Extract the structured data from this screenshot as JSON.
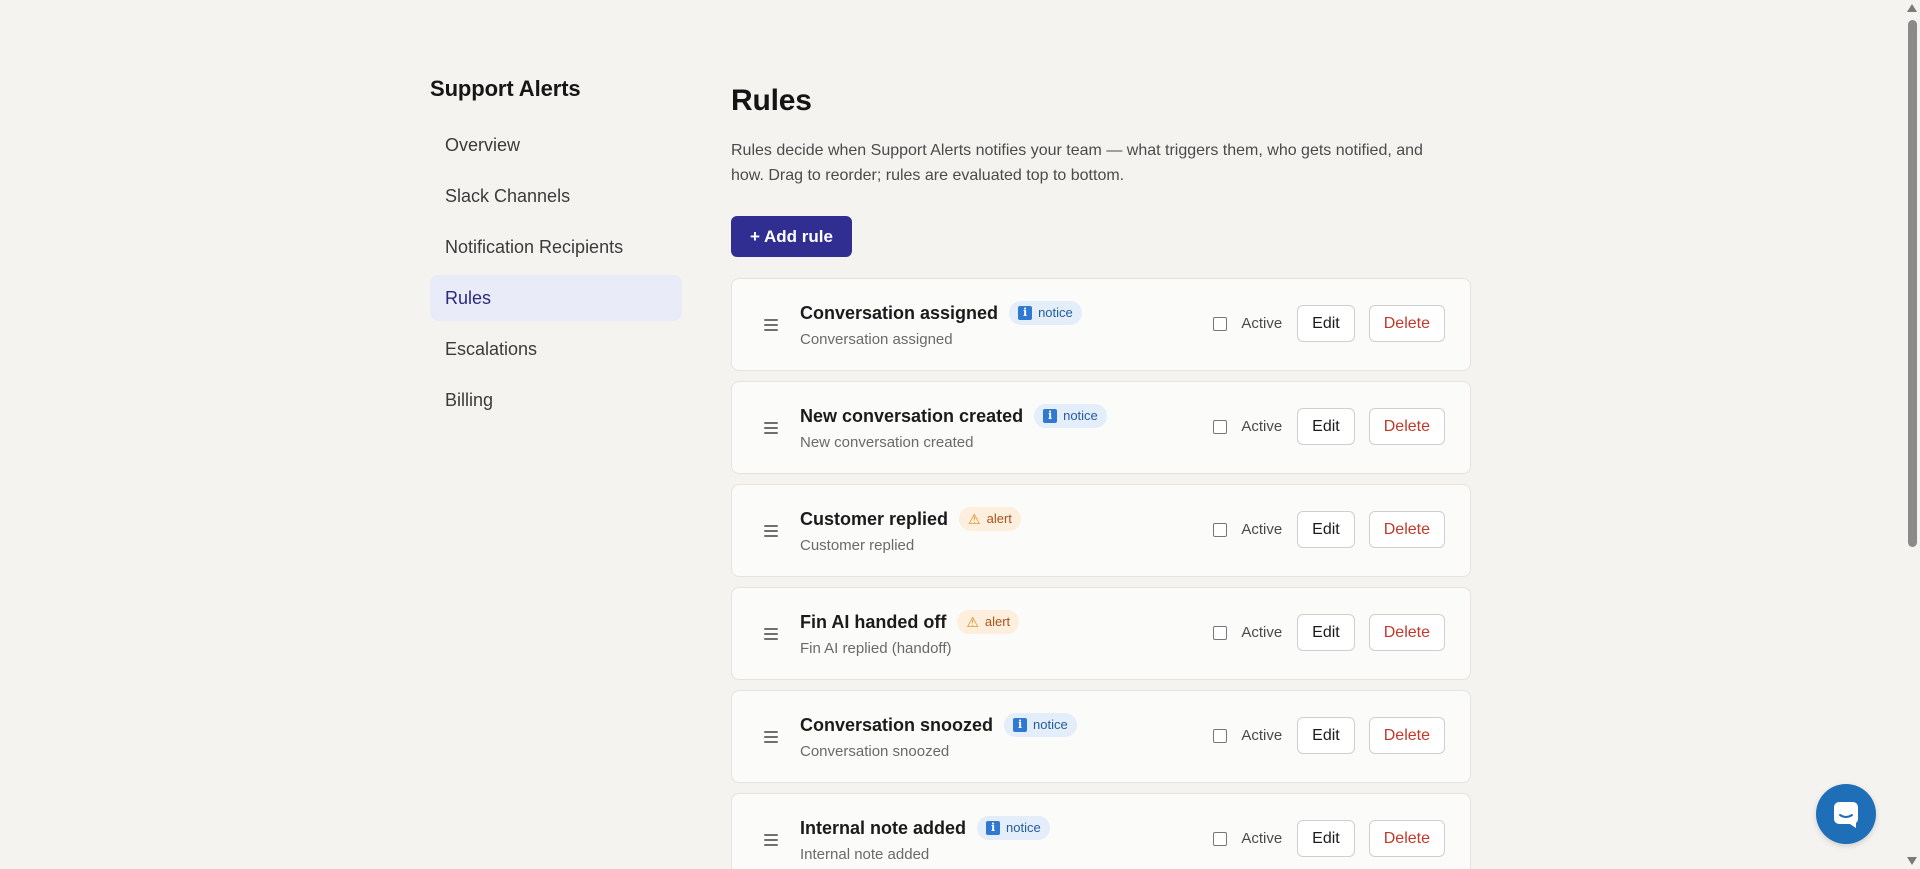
{
  "sidebar": {
    "brand": "Support Alerts",
    "items": [
      {
        "label": "Overview"
      },
      {
        "label": "Slack Channels"
      },
      {
        "label": "Notification Recipients"
      },
      {
        "label": "Rules"
      },
      {
        "label": "Escalations"
      },
      {
        "label": "Billing"
      }
    ],
    "active_item": "Rules"
  },
  "main": {
    "title": "Rules",
    "description": "Rules decide when Support Alerts notifies your team — what triggers them, who gets notified, and how. Drag to reorder; rules are evaluated top to bottom.",
    "add_button": "+ Add rule",
    "rules": [
      {
        "name": "Conversation assigned",
        "badge": "notice",
        "badge_icon": "info-icon",
        "subtitle": "Conversation assigned",
        "active_label": "Active",
        "active": false,
        "edit": "Edit",
        "delete": "Delete"
      },
      {
        "name": "New conversation created",
        "badge": "notice",
        "badge_icon": "info-icon",
        "subtitle": "New conversation created",
        "active_label": "Active",
        "active": false,
        "edit": "Edit",
        "delete": "Delete"
      },
      {
        "name": "Customer replied",
        "badge": "alert",
        "badge_icon": "warning-icon",
        "subtitle": "Customer replied",
        "active_label": "Active",
        "active": false,
        "edit": "Edit",
        "delete": "Delete"
      },
      {
        "name": "Fin AI handed off",
        "badge": "alert",
        "badge_icon": "warning-icon",
        "subtitle": "Fin AI replied (handoff)",
        "active_label": "Active",
        "active": false,
        "edit": "Edit",
        "delete": "Delete"
      },
      {
        "name": "Conversation snoozed",
        "badge": "notice",
        "badge_icon": "info-icon",
        "subtitle": "Conversation snoozed",
        "active_label": "Active",
        "active": false,
        "edit": "Edit",
        "delete": "Delete"
      },
      {
        "name": "Internal note added",
        "badge": "notice",
        "badge_icon": "info-icon",
        "subtitle": "Internal note added",
        "active_label": "Active",
        "active": false,
        "edit": "Edit",
        "delete": "Delete"
      }
    ]
  },
  "colors": {
    "background": "#f5f3ef",
    "primary": "#312e91",
    "nav_active_bg": "#e9ecf8",
    "notice_badge_bg": "#e4eefb",
    "notice_badge_text": "#245b9c",
    "alert_badge_bg": "#fdeedd",
    "alert_badge_text": "#a8541c",
    "delete_text": "#c0392b",
    "chat_launcher": "#1f6fb8"
  },
  "chat_launcher": {
    "icon": "chat-icon"
  }
}
